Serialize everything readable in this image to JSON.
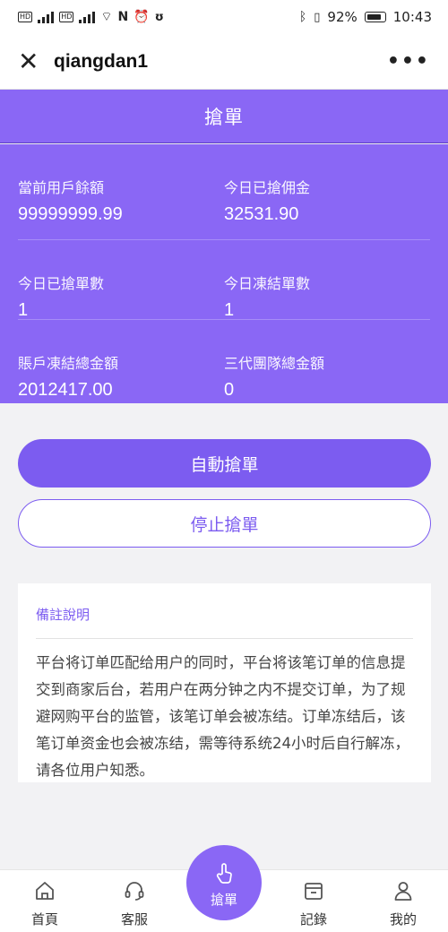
{
  "status_bar": {
    "network_left": "HD 4G HD 4G",
    "battery": "92%",
    "time": "10:43"
  },
  "title_bar": {
    "title": "qiangdan1",
    "close_icon": "close-icon",
    "more_icon": "more-icon"
  },
  "header": {
    "title": "搶單"
  },
  "stats": [
    {
      "label": "當前用戶餘額",
      "value": "99999999.99"
    },
    {
      "label": "今日已搶佣金",
      "value": "32531.90"
    },
    {
      "label": "今日已搶單數",
      "value": "1"
    },
    {
      "label": "今日凍結單數",
      "value": "1"
    },
    {
      "label": "賬戶凍結總金額",
      "value": "2012417.00"
    },
    {
      "label": "三代團隊總金額",
      "value": "0"
    }
  ],
  "buttons": {
    "auto": "自動搶單",
    "stop": "停止搶單"
  },
  "notes": {
    "title": "備註說明",
    "body": "平台将订单匹配给用户的同时，平台将该笔订单的信息提交到商家后台，若用户在两分钟之内不提交订单，为了规避网购平台的监管，该笔订单会被冻结。订单冻结后，该笔订单资金也会被冻结，需等待系统24小时后自行解冻，请各位用户知悉。"
  },
  "nav": {
    "home": "首頁",
    "service": "客服",
    "grab": "搶單",
    "records": "記錄",
    "mine": "我的"
  },
  "colors": {
    "accent": "#8a67f5",
    "button": "#7c5cf0"
  }
}
